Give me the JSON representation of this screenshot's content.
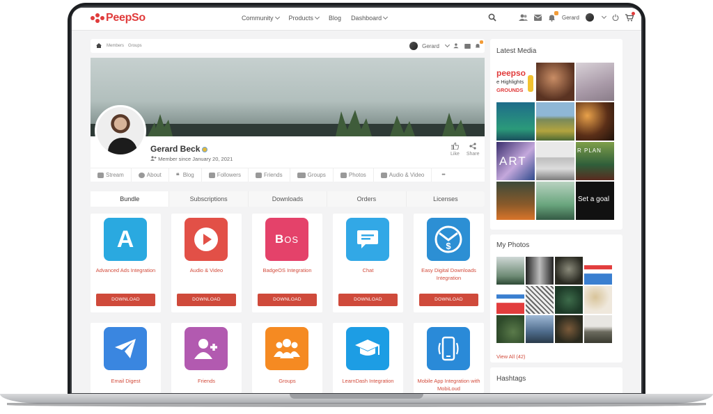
{
  "brand": {
    "name": "PeepSo",
    "accent": "#e03b3b"
  },
  "nav": {
    "items": [
      {
        "label": "Community",
        "has_caret": true
      },
      {
        "label": "Products",
        "has_caret": true
      },
      {
        "label": "Blog",
        "has_caret": false
      },
      {
        "label": "Dashboard",
        "has_caret": true
      }
    ],
    "user": "Gerard"
  },
  "breadcrumb": {
    "items": [
      "Members",
      "Groups"
    ],
    "user": "Gerard"
  },
  "profile": {
    "name": "Gerard Beck",
    "member_since": "Member since January 20, 2021",
    "like_label": "Like",
    "share_label": "Share"
  },
  "profile_tabs": [
    "Stream",
    "About",
    "Blog",
    "Followers",
    "Friends",
    "Groups",
    "Photos",
    "Audio & Video",
    "•••"
  ],
  "sub_tabs": [
    "Bundle",
    "Subscriptions",
    "Downloads",
    "Orders",
    "Licenses"
  ],
  "products_row1": [
    {
      "label": "Advanced Ads Integration",
      "icon": "a-letter-icon",
      "color": "#2aa9e0",
      "button": "DOWNLOAD"
    },
    {
      "label": "Audio & Video",
      "icon": "play-icon",
      "color": "#e25047",
      "button": "DOWNLOAD"
    },
    {
      "label": "BadgeOS Integration",
      "icon": "bos-logo-icon",
      "color": "#e4426a",
      "button": "DOWNLOAD"
    },
    {
      "label": "Chat",
      "icon": "chat-bubble-icon",
      "color": "#32a8e6",
      "button": "DOWNLOAD"
    },
    {
      "label": "Easy Digital Downloads Integration",
      "icon": "dollar-download-icon",
      "color": "#2c8fd4",
      "button": "DOWNLOAD"
    }
  ],
  "products_row2": [
    {
      "label": "Email Digest",
      "icon": "paper-plane-icon",
      "color": "#3a86e0"
    },
    {
      "label": "Friends",
      "icon": "add-friend-icon",
      "color": "#b25ab0"
    },
    {
      "label": "Groups",
      "icon": "group-icon",
      "color": "#f58a22"
    },
    {
      "label": "LearnDash Integration",
      "icon": "graduation-cap-icon",
      "color": "#1d9de4"
    },
    {
      "label": "Mobile App Integration with MobiLoud",
      "icon": "mobile-app-icon",
      "color": "#2a8ad8"
    }
  ],
  "sidebar": {
    "latest_media_title": "Latest Media",
    "media_texts": [
      "peepso",
      "e Highlights",
      "GROUNDS",
      "ART",
      "R PLAN",
      "Set a goal"
    ],
    "my_photos_title": "My Photos",
    "view_all": "View All (42)",
    "hashtags_title": "Hashtags"
  }
}
